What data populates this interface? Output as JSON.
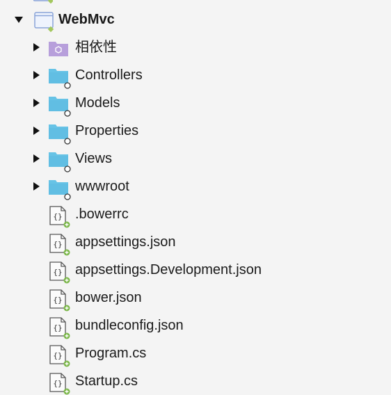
{
  "colors": {
    "background": "#f4f4f4",
    "folder": "#67c3e6",
    "folder_dark": "#55b4dc",
    "dependencies_folder": "#b79fdb",
    "add_badge": "#7ab648",
    "project_badge": "#a3c75e",
    "text": "#1a1a1a"
  },
  "tree": [
    {
      "label": "WebMvc",
      "icon": "project-icon",
      "expanded": true,
      "depth": 0,
      "bold": true
    },
    {
      "label": "相依性",
      "icon": "dependencies-folder-icon",
      "expanded": false,
      "depth": 1
    },
    {
      "label": "Controllers",
      "icon": "folder-icon",
      "expanded": false,
      "depth": 1
    },
    {
      "label": "Models",
      "icon": "folder-icon",
      "expanded": false,
      "depth": 1
    },
    {
      "label": "Properties",
      "icon": "folder-icon",
      "expanded": false,
      "depth": 1
    },
    {
      "label": "Views",
      "icon": "folder-icon",
      "expanded": false,
      "depth": 1
    },
    {
      "label": "wwwroot",
      "icon": "folder-icon",
      "expanded": false,
      "depth": 1
    },
    {
      "label": ".bowerrc",
      "icon": "json-file-icon",
      "depth": 1
    },
    {
      "label": "appsettings.json",
      "icon": "json-file-icon",
      "depth": 1
    },
    {
      "label": "appsettings.Development.json",
      "icon": "json-file-icon",
      "depth": 1
    },
    {
      "label": "bower.json",
      "icon": "json-file-icon",
      "depth": 1
    },
    {
      "label": "bundleconfig.json",
      "icon": "json-file-icon",
      "depth": 1
    },
    {
      "label": "Program.cs",
      "icon": "json-file-icon",
      "depth": 1
    },
    {
      "label": "Startup.cs",
      "icon": "json-file-icon",
      "depth": 1
    }
  ]
}
